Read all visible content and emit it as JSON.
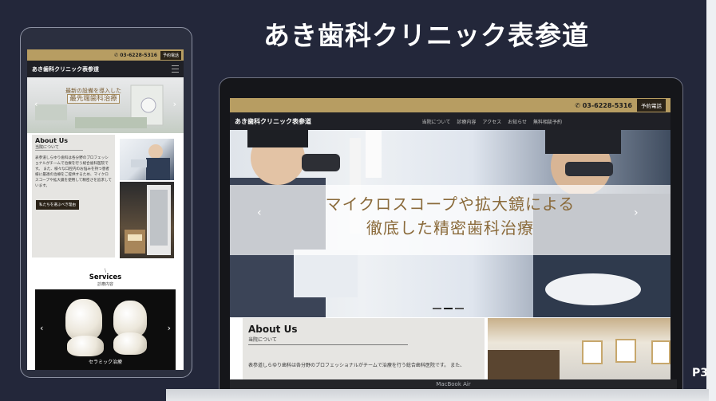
{
  "slide": {
    "title": "あき歯科クリニック表参道",
    "page": "P3"
  },
  "site": {
    "clinic_name": "あき歯科クリニック表参道",
    "phone": "03-6228-5316",
    "reserve_label": "予約電話",
    "nav": [
      "当院について",
      "診療内容",
      "アクセス",
      "お知らせ",
      "無料相談予約"
    ]
  },
  "mobile": {
    "hero_caption_line1": "最新の設備を導入した",
    "hero_caption_line2": "最先端歯科治療",
    "about_title": "About Us",
    "about_sub": "当院について",
    "about_text": "表参道しらゆり歯科は各分野のプロフェッショナルがチームで治療を行う総合歯科医院です。 また、様々な口腔内のお悩みを持つ患者様に最適の治療をご提供するため、マイクロスコープや拡大鏡を使用して精密さを追求しています。",
    "about_button": "私たちを選ぶべき理由",
    "services_marker": "\\",
    "services_title": "Services",
    "services_sub": "診療内容",
    "services_caption": "セラミック治療"
  },
  "desktop": {
    "hero_line1": "マイクロスコープや拡大鏡による",
    "hero_line2": "徹底した精密歯科治療",
    "about_title": "About Us",
    "about_sub": "当院について",
    "about_text": "表参道しらゆり歯科は各分野のプロフェッショナルがチームで治療を行う総合歯科医院です。 また、"
  },
  "device_label": "MacBook Air",
  "icons": {
    "phone": "phone-icon",
    "menu": "hamburger-menu-icon",
    "prev": "chevron-left-icon",
    "next": "chevron-right-icon"
  },
  "colors": {
    "gold": "#b79d62",
    "navbar": "#1f2026",
    "background": "#23273a"
  }
}
